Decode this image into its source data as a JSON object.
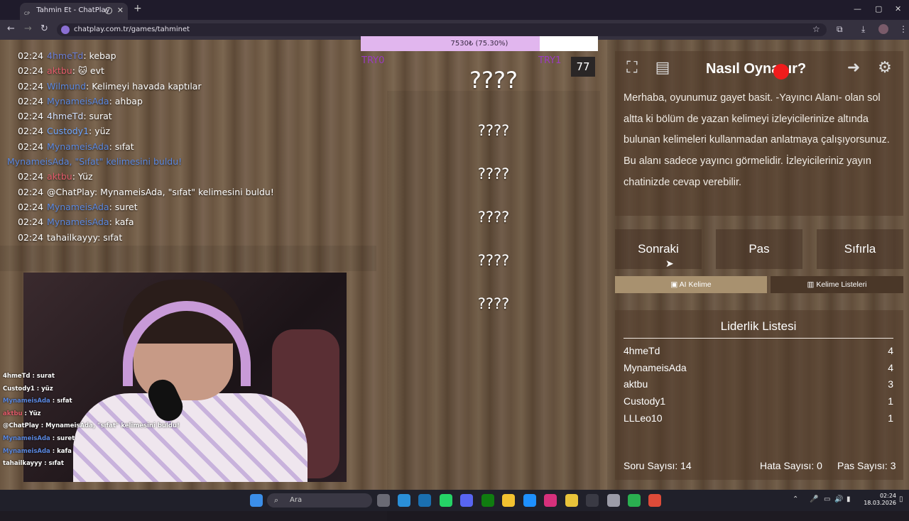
{
  "browser": {
    "tab_title": "Tahmin Et - ChatPlay",
    "tab_favicon": "CP",
    "url": "chatplay.com.tr/games/tahminet"
  },
  "chat": [
    {
      "time": "02:24",
      "user": "4hmeTd",
      "user_color": "#6b7fd7",
      "msg": ": kebap"
    },
    {
      "time": "02:24",
      "user": "aktbu",
      "user_color": "#e25c6b",
      "msg": ": 🐱 evt"
    },
    {
      "time": "02:24",
      "user": "Wilmund",
      "user_color": "#5b88e0",
      "msg": ": Kelimeyi havada kaptılar"
    },
    {
      "time": "02:24",
      "user": "MynameisAda",
      "user_color": "#5b88e0",
      "msg": ": ahbap"
    },
    {
      "time": "02:24",
      "user": "4hmeTd",
      "user_color": "#d2e0ff",
      "msg": ": surat"
    },
    {
      "time": "02:24",
      "user": "Custody1",
      "user_color": "#6ea6ff",
      "msg": ": yüz"
    },
    {
      "time": "02:24",
      "user": "MynameisAda",
      "user_color": "#5b88e0",
      "msg": ": sıfat"
    },
    {
      "time": "",
      "user": "",
      "user_color": "#5b88e0",
      "msg": "MynameisAda, \"Sıfat\" kelimesini buldu!",
      "msg_color": "#5b88e0"
    },
    {
      "time": "02:24",
      "user": "aktbu",
      "user_color": "#e25c6b",
      "msg": ": Yüz"
    },
    {
      "time": "02:24",
      "user": "@ChatPlay",
      "user_color": "#fff",
      "msg": ": MynameisAda, \"sıfat\" kelimesini buldu!"
    },
    {
      "time": "02:24",
      "user": "MynameisAda",
      "user_color": "#5b88e0",
      "msg": ": suret"
    },
    {
      "time": "02:24",
      "user": "MynameisAda",
      "user_color": "#5b88e0",
      "msg": ": kafa"
    },
    {
      "time": "02:24",
      "user": "tahailkayyy",
      "user_color": "#fff",
      "msg": ": sıfat"
    }
  ],
  "overlay_chat": [
    {
      "user": "4hmeTd",
      "user_color": "#fff",
      "msg": " : surat"
    },
    {
      "user": "Custody1",
      "user_color": "#fff",
      "msg": " : yüz"
    },
    {
      "user": "MynameisAda",
      "user_color": "#5b88e0",
      "msg": " : sıfat"
    },
    {
      "user": "aktbu",
      "user_color": "#e25c6b",
      "msg": " : Yüz"
    },
    {
      "user": "@ChatPlay",
      "user_color": "#fff",
      "msg": " : MynameisAda, \"sıfat\" kelimesini buldu!"
    },
    {
      "user": "MynameisAda",
      "user_color": "#5b88e0",
      "msg": " : suret"
    },
    {
      "user": "MynameisAda",
      "user_color": "#5b88e0",
      "msg": " : kafa"
    },
    {
      "user": "tahailkayyy",
      "user_color": "#fff",
      "msg": " : sıfat"
    }
  ],
  "game": {
    "progress_text": "7530₺ (75.30%)",
    "progress_fraction": 0.753,
    "try_left": "TRY0",
    "try_right": "TRY1",
    "timer": "77",
    "main_word": "????",
    "hidden_words": [
      "????",
      "????",
      "????",
      "????",
      "????"
    ]
  },
  "help": {
    "title": "Nasıl Oynanır?",
    "description": "Merhaba, oyunumuz gayet basit. -Yayıncı Alanı- olan sol altta ki bölüm de yazan kelimeyi izleyicilerinize altında bulunan kelimeleri kullanmadan anlatmaya çalışıyorsunuz. Bu alanı sadece yayıncı görmelidir. İzleyicileriniz yayın chatinizde cevap verebilir."
  },
  "buttons": {
    "next": "Sonraki",
    "pass": "Pas",
    "reset": "Sıfırla"
  },
  "tabs": {
    "ai": "AI Kelime",
    "lists": "Kelime Listeleri"
  },
  "leaderboard": {
    "title": "Liderlik Listesi",
    "rows": [
      {
        "name": "4hmeTd",
        "score": "4"
      },
      {
        "name": "MynameisAda",
        "score": "4"
      },
      {
        "name": "aktbu",
        "score": "3"
      },
      {
        "name": "Custody1",
        "score": "1"
      },
      {
        "name": "LLLeo10",
        "score": "1"
      }
    ]
  },
  "stats": {
    "questions": "Soru Sayısı: 14",
    "errors": "Hata Sayısı: 0",
    "passes": "Pas Sayısı: 3"
  },
  "taskbar": {
    "search_placeholder": "Ara",
    "time": "02:24",
    "date": "18.03.2026"
  }
}
